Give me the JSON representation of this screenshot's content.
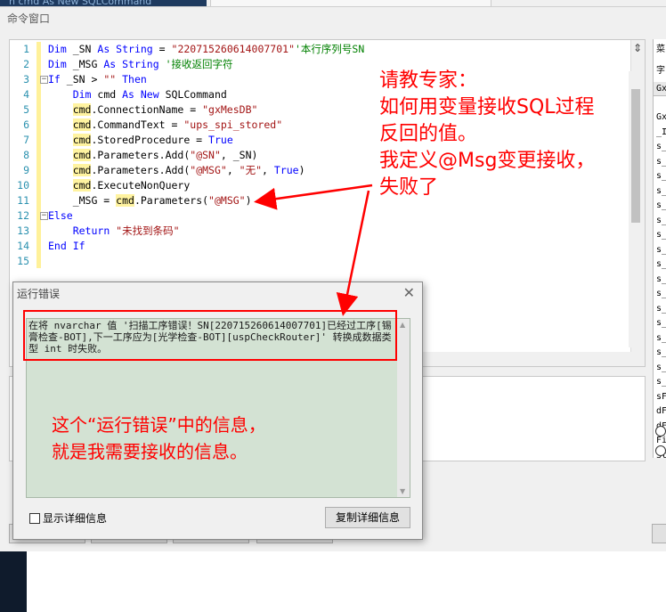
{
  "background": {
    "window_title": "命令窗口",
    "top_tab_text": "n cmd As New SQLCommand"
  },
  "editor": {
    "lines": [
      {
        "n": "1",
        "fold": "",
        "segments": [
          {
            "c": "k",
            "t": "Dim "
          },
          {
            "c": "t",
            "t": "_SN "
          },
          {
            "c": "k",
            "t": "As String "
          },
          {
            "c": "t",
            "t": "= "
          },
          {
            "c": "s",
            "t": "\"220715260614007701\""
          },
          {
            "c": "c",
            "t": "'本行序列号SN"
          }
        ]
      },
      {
        "n": "2",
        "fold": "",
        "segments": [
          {
            "c": "k",
            "t": "Dim "
          },
          {
            "c": "t",
            "t": "_MSG "
          },
          {
            "c": "k",
            "t": "As String "
          },
          {
            "c": "c",
            "t": "'接收返回字符"
          }
        ]
      },
      {
        "n": "3",
        "fold": "−",
        "segments": [
          {
            "c": "k",
            "t": "If "
          },
          {
            "c": "t",
            "t": "_SN > "
          },
          {
            "c": "s",
            "t": "\"\" "
          },
          {
            "c": "k",
            "t": "Then"
          }
        ]
      },
      {
        "n": "4",
        "fold": "",
        "segments": [
          {
            "c": "t",
            "t": "    "
          },
          {
            "c": "k",
            "t": "Dim "
          },
          {
            "c": "t",
            "t": "cmd "
          },
          {
            "c": "k",
            "t": "As New "
          },
          {
            "c": "t",
            "t": "SQLCommand"
          }
        ]
      },
      {
        "n": "5",
        "fold": "",
        "segments": [
          {
            "c": "t",
            "t": "    "
          },
          {
            "c": "hl",
            "t": "cmd"
          },
          {
            "c": "t",
            "t": ".ConnectionName = "
          },
          {
            "c": "s",
            "t": "\"gxMesDB\""
          }
        ]
      },
      {
        "n": "6",
        "fold": "",
        "segments": [
          {
            "c": "t",
            "t": "    "
          },
          {
            "c": "hl",
            "t": "cmd"
          },
          {
            "c": "t",
            "t": ".CommandText = "
          },
          {
            "c": "s",
            "t": "\"ups_spi_stored\""
          }
        ]
      },
      {
        "n": "7",
        "fold": "",
        "segments": [
          {
            "c": "t",
            "t": "    "
          },
          {
            "c": "hl",
            "t": "cmd"
          },
          {
            "c": "t",
            "t": ".StoredProcedure = "
          },
          {
            "c": "k",
            "t": "True"
          }
        ]
      },
      {
        "n": "8",
        "fold": "",
        "segments": [
          {
            "c": "t",
            "t": "    "
          },
          {
            "c": "hl",
            "t": "cmd"
          },
          {
            "c": "t",
            "t": ".Parameters.Add("
          },
          {
            "c": "s",
            "t": "\"@SN\""
          },
          {
            "c": "t",
            "t": ", _SN)"
          }
        ]
      },
      {
        "n": "9",
        "fold": "",
        "segments": [
          {
            "c": "t",
            "t": "    "
          },
          {
            "c": "hl",
            "t": "cmd"
          },
          {
            "c": "t",
            "t": ".Parameters.Add("
          },
          {
            "c": "s",
            "t": "\"@MSG\""
          },
          {
            "c": "t",
            "t": ", "
          },
          {
            "c": "s",
            "t": "\"无\""
          },
          {
            "c": "t",
            "t": ", "
          },
          {
            "c": "k",
            "t": "True"
          },
          {
            "c": "t",
            "t": ")"
          }
        ]
      },
      {
        "n": "10",
        "fold": "",
        "segments": [
          {
            "c": "t",
            "t": "    "
          },
          {
            "c": "hl",
            "t": "cmd"
          },
          {
            "c": "t",
            "t": ".ExecuteNonQuery"
          }
        ]
      },
      {
        "n": "11",
        "fold": "",
        "segments": [
          {
            "c": "t",
            "t": "    _MSG = "
          },
          {
            "c": "hl",
            "t": "cmd"
          },
          {
            "c": "t",
            "t": ".Parameters("
          },
          {
            "c": "s",
            "t": "\"@MSG\""
          },
          {
            "c": "t",
            "t": ")"
          }
        ]
      },
      {
        "n": "12",
        "fold": "−",
        "segments": [
          {
            "c": "k",
            "t": "Else"
          }
        ]
      },
      {
        "n": "13",
        "fold": "",
        "segments": [
          {
            "c": "t",
            "t": "    "
          },
          {
            "c": "k",
            "t": "Return "
          },
          {
            "c": "s",
            "t": "\"未找到条码\""
          }
        ]
      },
      {
        "n": "14",
        "fold": "",
        "segments": [
          {
            "c": "k",
            "t": "End If"
          }
        ]
      },
      {
        "n": "15",
        "fold": "",
        "segments": []
      }
    ]
  },
  "right_panel": {
    "header": "菜",
    "row1": "字",
    "column_header": "GxM",
    "items": [
      "GxM",
      "_ID",
      "s_c",
      "s_g",
      "s_s",
      "s_l",
      "s_s",
      "s_w",
      "s_M",
      "s_c",
      "s_t",
      "s_s",
      "s_U",
      "s_R",
      "s_R",
      "s_R",
      "s_R",
      "s_A",
      "s_R",
      "sFi",
      "dFi",
      "dFi",
      "Fil",
      "Sta"
    ]
  },
  "dialog": {
    "title": "运行错误",
    "close_glyph": "✕",
    "message": "在将 nvarchar 值 '扫描工序错误！SN[220715260614007701]已经过工序[锡膏检查-BOT],下一工序应为[光学检查-BOT][uspCheckRouter]' 转换成数据类型 int 时失败。",
    "show_details_label": "显示详细信息",
    "copy_details_label": "复制详细信息"
  },
  "annotations": {
    "top_lines": [
      "请教专家：",
      "如何用变量接收SQL过程",
      "反回的值。",
      "我定义@Msg变更接收，",
      "失败了"
    ],
    "bottom_lines": [
      "这个“运行错误”中的信息，",
      "就是我需要接收的信息。"
    ],
    "color": "#ff0000"
  },
  "colors": {
    "keyword": "#0000ff",
    "string": "#a31515",
    "comment": "#008000",
    "line_number": "#2b91af",
    "message_bg": "#d3e2d3"
  }
}
